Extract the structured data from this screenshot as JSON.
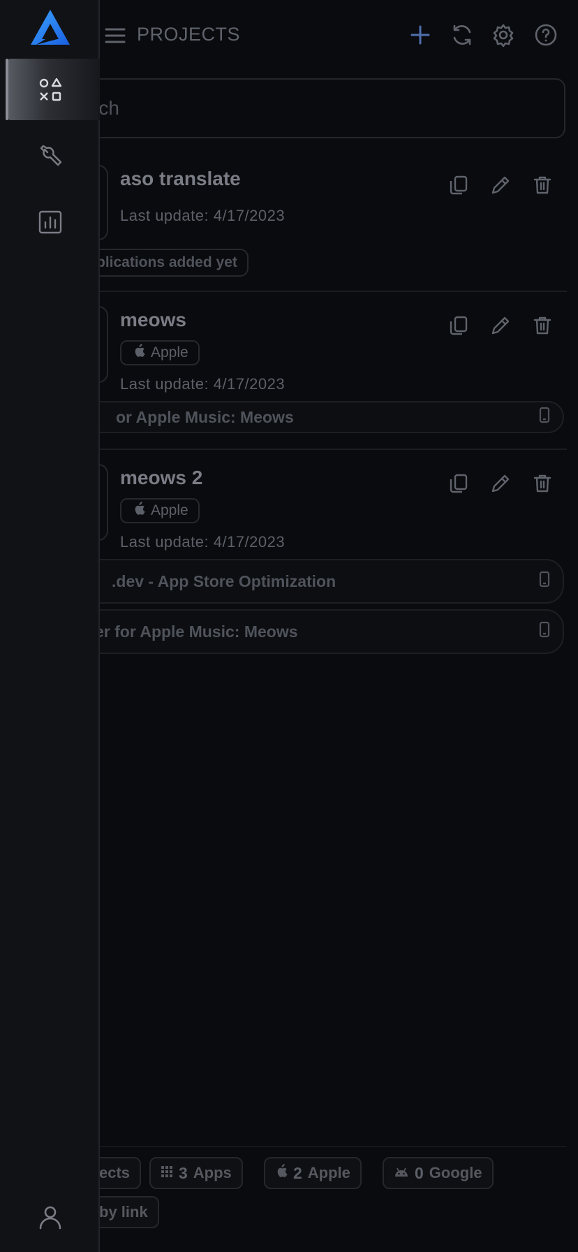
{
  "header": {
    "title": "PROJECTS",
    "actions": [
      "add-icon",
      "refresh-icon",
      "gear-icon",
      "help-icon"
    ]
  },
  "search": {
    "placeholder": "Search",
    "visible_text": "rch"
  },
  "projects": [
    {
      "name": "aso translate",
      "last_update": "Last update: 4/17/2023",
      "platform": null,
      "apps": [],
      "empty_note": "plications added yet"
    },
    {
      "name": "meows",
      "last_update": "Last update: 4/17/2023",
      "platform": "Apple",
      "apps": [
        {
          "label": "or Apple Music: Meows",
          "icon": "phone-icon"
        }
      ]
    },
    {
      "name": "meows 2",
      "last_update": "Last update: 4/17/2023",
      "platform": "Apple",
      "apps": [
        {
          "label": ".dev - App Store Optimization",
          "icon": "phone-icon"
        },
        {
          "label": "er for Apple Music: Meows",
          "icon": "phone-icon"
        }
      ]
    }
  ],
  "footer": {
    "chips": [
      {
        "label": "ects",
        "count": ""
      },
      {
        "label": "Apps",
        "count": "3",
        "icon": "grid-icon"
      },
      {
        "label": "Apple",
        "count": "2",
        "icon": "apple-icon"
      },
      {
        "label": "Google",
        "count": "0",
        "icon": "android-icon"
      },
      {
        "label": "by link",
        "count": ""
      }
    ]
  },
  "sidebar": {
    "items": [
      {
        "name": "projects",
        "icon": "shapes-icon",
        "active": true
      },
      {
        "name": "tools",
        "icon": "wrench-icon",
        "active": false
      },
      {
        "name": "analytics",
        "icon": "chart-icon",
        "active": false
      }
    ],
    "bottom_icon": "user-icon"
  },
  "colors": {
    "accent": "#3b82f6",
    "background": "#0a0b0e",
    "sidebar": "#111216"
  }
}
